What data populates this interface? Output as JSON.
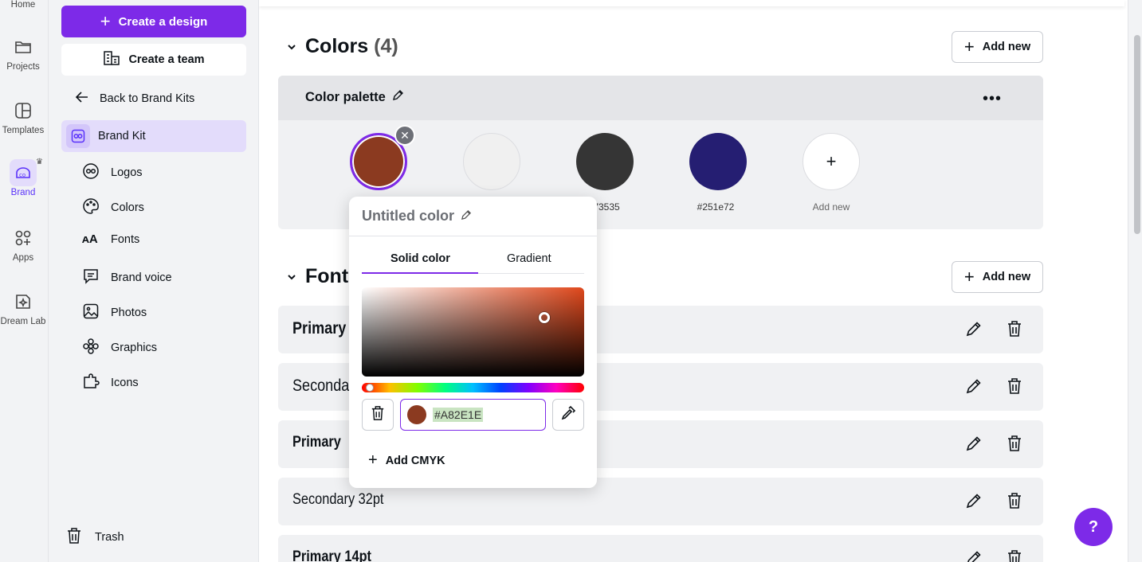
{
  "rail": {
    "items": [
      {
        "label": "Home"
      },
      {
        "label": "Projects"
      },
      {
        "label": "Templates"
      },
      {
        "label": "Brand"
      },
      {
        "label": "Apps"
      },
      {
        "label": "Dream Lab"
      }
    ]
  },
  "sidebar": {
    "create_design": "Create a design",
    "create_team": "Create a team",
    "back": "Back to Brand Kits",
    "brand_kit": "Brand Kit",
    "items": [
      {
        "label": "Logos"
      },
      {
        "label": "Colors"
      },
      {
        "label": "Fonts"
      },
      {
        "label": "Brand voice"
      },
      {
        "label": "Photos"
      },
      {
        "label": "Graphics"
      },
      {
        "label": "Icons"
      }
    ],
    "trash": "Trash"
  },
  "colors_section": {
    "title": "Colors",
    "count": "(4)",
    "add_new": "Add new",
    "palette_title": "Color palette",
    "swatches": [
      {
        "color": "#8b3a20",
        "label": ""
      },
      {
        "color": "#f0f0f0",
        "label": ""
      },
      {
        "color": "#353535",
        "label": "73535"
      },
      {
        "color": "#251e72",
        "label": "#251e72"
      }
    ],
    "add_label": "Add new"
  },
  "fonts_section": {
    "title": "Fonts",
    "add_new": "Add new",
    "rows": [
      {
        "label": "Primary"
      },
      {
        "label": "Seconda"
      },
      {
        "label": "Primary"
      },
      {
        "label": "Secondary 32pt"
      },
      {
        "label": "Primary 14pt"
      }
    ]
  },
  "color_popup": {
    "title": "Untitled color",
    "tab_solid": "Solid color",
    "tab_gradient": "Gradient",
    "hex_value": "#A82E1E",
    "add_cmyk": "Add CMYK"
  },
  "help": "?"
}
